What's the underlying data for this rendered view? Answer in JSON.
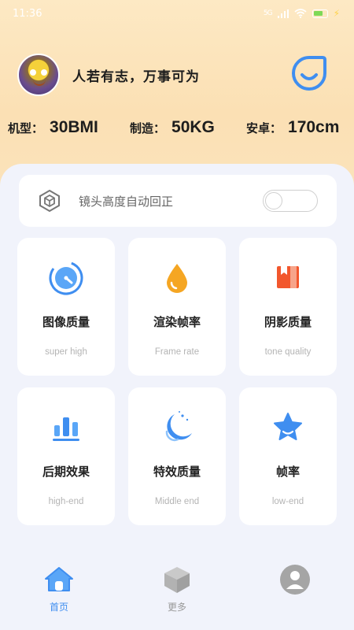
{
  "status_bar": {
    "time": "11:36",
    "signal": "5G",
    "battery_icon": "battery-icon",
    "charging_icon": "bolt-icon"
  },
  "profile": {
    "motto": "人若有志，万事可为",
    "avatar_icon": "avatar",
    "action_icon": "smile-icon"
  },
  "specs": [
    {
      "label": "机型：",
      "value": "30BMI"
    },
    {
      "label": "制造：",
      "value": "50KG"
    },
    {
      "label": "安卓：",
      "value": "170cm"
    }
  ],
  "toggle": {
    "label": "镜头高度自动回正",
    "icon": "hexagon-cube-icon",
    "enabled": false
  },
  "tiles": [
    {
      "title": "图像质量",
      "subtitle": "super high",
      "icon": "gauge-icon"
    },
    {
      "title": "渲染帧率",
      "subtitle": "Frame rate",
      "icon": "drop-icon"
    },
    {
      "title": "阴影质量",
      "subtitle": "tone quality",
      "icon": "bookmark-icon"
    },
    {
      "title": "后期效果",
      "subtitle": "high-end",
      "icon": "bar-chart-icon"
    },
    {
      "title": "特效质量",
      "subtitle": "Middle end",
      "icon": "moon-icon"
    },
    {
      "title": "帧率",
      "subtitle": "low-end",
      "icon": "star-icon"
    }
  ],
  "nav": [
    {
      "label": "首页",
      "icon": "home-icon",
      "active": true
    },
    {
      "label": "更多",
      "icon": "cube-icon",
      "active": false
    },
    {
      "label": "",
      "icon": "user-icon",
      "active": false
    }
  ],
  "colors": {
    "accent": "#3f8ef0",
    "header_bg": "#fbe3bc",
    "page_bg": "#f1f3fb",
    "drop": "#f5a623",
    "bookmark": "#f2572d"
  }
}
